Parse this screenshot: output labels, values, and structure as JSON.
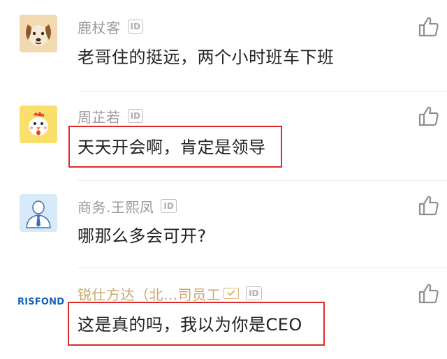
{
  "comments": [
    {
      "avatar_icon": "dog-icon",
      "name": "鹿杖客",
      "id_badge": "ID",
      "text": "老哥住的挺远，两个小时班车下班",
      "highlighted": false
    },
    {
      "avatar_icon": "chicken-icon",
      "name": "周芷若",
      "id_badge": "ID",
      "text": "天天开会啊，肯定是领导",
      "highlighted": true
    },
    {
      "avatar_icon": "person-icon",
      "name": "商务.王熙凤",
      "id_badge": "ID",
      "text": "哪那么多会可开?",
      "highlighted": false
    },
    {
      "avatar_icon": "company-logo",
      "logo_text": "RISFOND",
      "name": "锐仕方达（北...司员工",
      "verified_icon": "verified-badge-icon",
      "id_badge": "ID",
      "text": "这是真的吗，我以为你是CEO",
      "highlighted": true
    }
  ],
  "colors": {
    "name": "#9a9a9a",
    "name_gold": "#c9a96c",
    "text": "#222222",
    "highlight_border": "#e02a2a",
    "icon": "#8f8f8f",
    "logo_blue": "#1a63b8"
  },
  "like_icon": "thumbs-up-icon"
}
